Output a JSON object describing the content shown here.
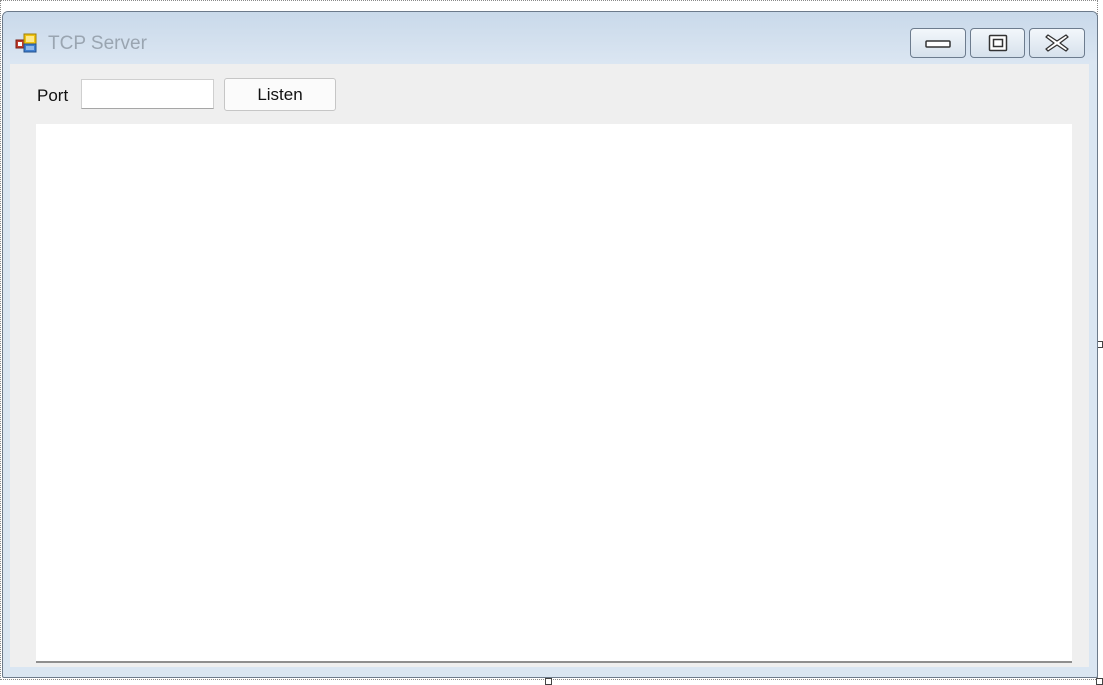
{
  "window": {
    "title": "TCP Server",
    "icon": "windows-forms-app-icon",
    "controls": {
      "minimize_icon": "minimize-icon",
      "maximize_icon": "maximize-icon",
      "close_icon": "close-icon"
    }
  },
  "toolbar": {
    "port_label": "Port",
    "port_value": "",
    "listen_label": "Listen"
  },
  "output": {
    "text": ""
  },
  "colors": {
    "title_text": "#9aa5b1",
    "window_frame": "#dae6f2",
    "client_background": "#efefef",
    "output_background": "#ffffff"
  }
}
